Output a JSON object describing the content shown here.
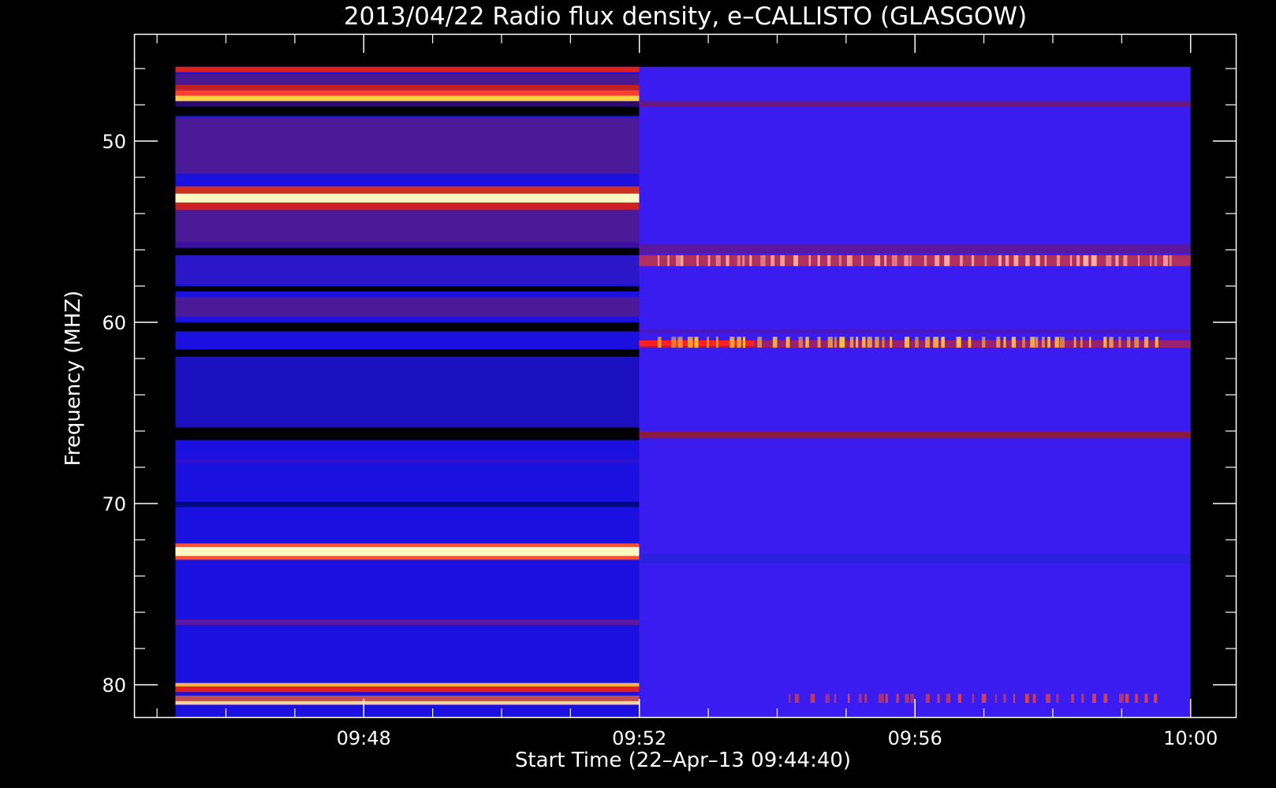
{
  "chart_data": {
    "type": "heatmap",
    "title": "2013/04/22  Radio flux density, e–CALLISTO (GLASGOW)",
    "xlabel": "Start Time (22–Apr–13 09:44:40)",
    "ylabel": "Frequency (MHZ)",
    "x_tick_labels": [
      "09:48",
      "09:52",
      "09:56",
      "10:00"
    ],
    "x_tick_minutes": [
      3.333,
      7.333,
      11.333,
      15.333
    ],
    "y_tick_labels": [
      "50",
      "60",
      "70",
      "80"
    ],
    "y_tick_values": [
      50,
      60,
      70,
      80
    ],
    "xlim_minutes": [
      0,
      16
    ],
    "data_xlim_minutes": [
      0.6,
      15.333
    ],
    "ylim_mhz": [
      45,
      81.5
    ],
    "data_ylim_mhz": [
      45.9,
      81.8
    ],
    "y_inverted": true,
    "segment_split_minute": 7.33,
    "background_colors": {
      "left": "#1a10e0",
      "right": "#3a1cf0"
    },
    "bands": [
      {
        "segment": "left",
        "from": 45.9,
        "to": 46.2,
        "color": "#e02020"
      },
      {
        "segment": "left",
        "from": 46.3,
        "to": 46.9,
        "color": "#4a1890"
      },
      {
        "segment": "left",
        "from": 46.9,
        "to": 47.2,
        "color": "#c02020"
      },
      {
        "segment": "left",
        "from": 47.2,
        "to": 47.5,
        "color": "#ff4030"
      },
      {
        "segment": "left",
        "from": 47.5,
        "to": 47.8,
        "color": "#ffd040"
      },
      {
        "segment": "left",
        "from": 47.8,
        "to": 48.1,
        "color": "#2a0a70"
      },
      {
        "segment": "left",
        "from": 48.1,
        "to": 48.6,
        "color": "#000000"
      },
      {
        "segment": "left",
        "from": 48.7,
        "to": 51.8,
        "color": "#4a1a98"
      },
      {
        "segment": "left",
        "from": 52.5,
        "to": 52.9,
        "color": "#d03020"
      },
      {
        "segment": "left",
        "from": 52.9,
        "to": 53.4,
        "color": "#fff8c0"
      },
      {
        "segment": "left",
        "from": 53.4,
        "to": 53.8,
        "color": "#d02020"
      },
      {
        "segment": "left",
        "from": 53.8,
        "to": 55.6,
        "color": "#4a1a98"
      },
      {
        "segment": "left",
        "from": 55.6,
        "to": 55.9,
        "color": "#3a10a0"
      },
      {
        "segment": "left",
        "from": 55.9,
        "to": 56.3,
        "color": "#000000"
      },
      {
        "segment": "left",
        "from": 56.3,
        "to": 57.9,
        "color": "#2a18c8"
      },
      {
        "segment": "left",
        "from": 58.0,
        "to": 58.3,
        "color": "#000000"
      },
      {
        "segment": "left",
        "from": 58.6,
        "to": 59.7,
        "color": "#4a1a98"
      },
      {
        "segment": "left",
        "from": 60.0,
        "to": 60.5,
        "color": "#000000"
      },
      {
        "segment": "left",
        "from": 61.5,
        "to": 61.9,
        "color": "#000000"
      },
      {
        "segment": "left",
        "from": 62.0,
        "to": 65.8,
        "color": "#1a10c0"
      },
      {
        "segment": "left",
        "from": 65.8,
        "to": 66.5,
        "color": "#000000"
      },
      {
        "segment": "left",
        "from": 67.5,
        "to": 67.8,
        "color": "#2a10d0"
      },
      {
        "segment": "left",
        "from": 69.9,
        "to": 70.2,
        "color": "#000a80"
      },
      {
        "segment": "left",
        "from": 72.2,
        "to": 72.4,
        "color": "#ff5030"
      },
      {
        "segment": "left",
        "from": 72.4,
        "to": 72.9,
        "color": "#fff8c0"
      },
      {
        "segment": "left",
        "from": 72.9,
        "to": 73.1,
        "color": "#ff5030"
      },
      {
        "segment": "left",
        "from": 76.4,
        "to": 76.7,
        "color": "#5a18a0"
      },
      {
        "segment": "left",
        "from": 79.9,
        "to": 80.1,
        "color": "#ffb040"
      },
      {
        "segment": "left",
        "from": 80.1,
        "to": 80.4,
        "color": "#e02020"
      },
      {
        "segment": "left",
        "from": 80.6,
        "to": 80.9,
        "color": "#c05050"
      },
      {
        "segment": "left",
        "from": 80.9,
        "to": 81.1,
        "color": "#ffd0a0"
      },
      {
        "segment": "right",
        "from": 47.8,
        "to": 48.1,
        "color": "#6a1880"
      },
      {
        "segment": "right",
        "from": 55.7,
        "to": 56.2,
        "color": "#5a18a0"
      },
      {
        "segment": "right",
        "from": 56.3,
        "to": 56.9,
        "color": "#b03060"
      },
      {
        "segment": "right",
        "from": 60.4,
        "to": 60.6,
        "color": "#4a18c0"
      },
      {
        "segment": "right",
        "from": 61.0,
        "to": 61.4,
        "color": "#9a2070"
      },
      {
        "segment": "right",
        "from": 66.0,
        "to": 66.4,
        "color": "#8a1a40"
      },
      {
        "segment": "right",
        "from": 72.8,
        "to": 73.3,
        "color": "#2a20e0"
      }
    ],
    "features": [
      {
        "from_minute": 7.33,
        "to_minute": 9.0,
        "from": 61.0,
        "to": 61.3,
        "color": "#ff2020"
      },
      {
        "from_minute": 7.6,
        "to_minute": 15.2,
        "from": 56.3,
        "to": 56.9,
        "color": "#ffb0a0",
        "pattern": "bursts"
      },
      {
        "from_minute": 7.6,
        "to_minute": 15.0,
        "from": 60.8,
        "to": 61.4,
        "color": "#ffc040",
        "pattern": "bursts"
      },
      {
        "from_minute": 9.5,
        "to_minute": 15.0,
        "from": 80.5,
        "to": 81.0,
        "color": "#e04040",
        "pattern": "bursts"
      }
    ]
  }
}
